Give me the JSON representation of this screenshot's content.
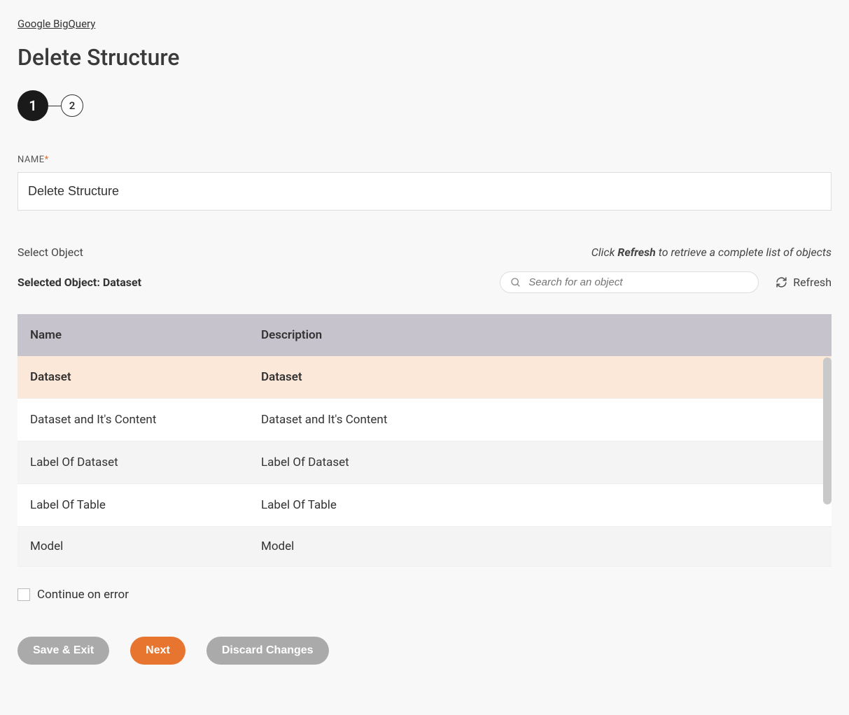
{
  "breadcrumb": "Google BigQuery",
  "title": "Delete Structure",
  "steps": {
    "active": "1",
    "next": "2"
  },
  "nameField": {
    "label": "NAME",
    "value": "Delete Structure"
  },
  "selectObject": {
    "label": "Select Object",
    "hint_click": "Click ",
    "hint_refresh": "Refresh",
    "hint_rest": " to retrieve a complete list of objects"
  },
  "selectedObject": {
    "prefix": "Selected Object: ",
    "value": "Dataset"
  },
  "search": {
    "placeholder": "Search for an object"
  },
  "refresh": "Refresh",
  "table": {
    "headers": {
      "name": "Name",
      "desc": "Description"
    },
    "rows": [
      {
        "name": "Dataset",
        "desc": "Dataset",
        "selected": true
      },
      {
        "name": "Dataset and It's Content",
        "desc": "Dataset and It's Content"
      },
      {
        "name": "Label Of Dataset",
        "desc": "Label Of Dataset",
        "alt": true
      },
      {
        "name": "Label Of Table",
        "desc": "Label Of Table"
      },
      {
        "name": "Model",
        "desc": "Model",
        "alt": true,
        "cut": true
      }
    ]
  },
  "continueOnError": "Continue on error",
  "buttons": {
    "save": "Save & Exit",
    "next": "Next",
    "discard": "Discard Changes"
  }
}
